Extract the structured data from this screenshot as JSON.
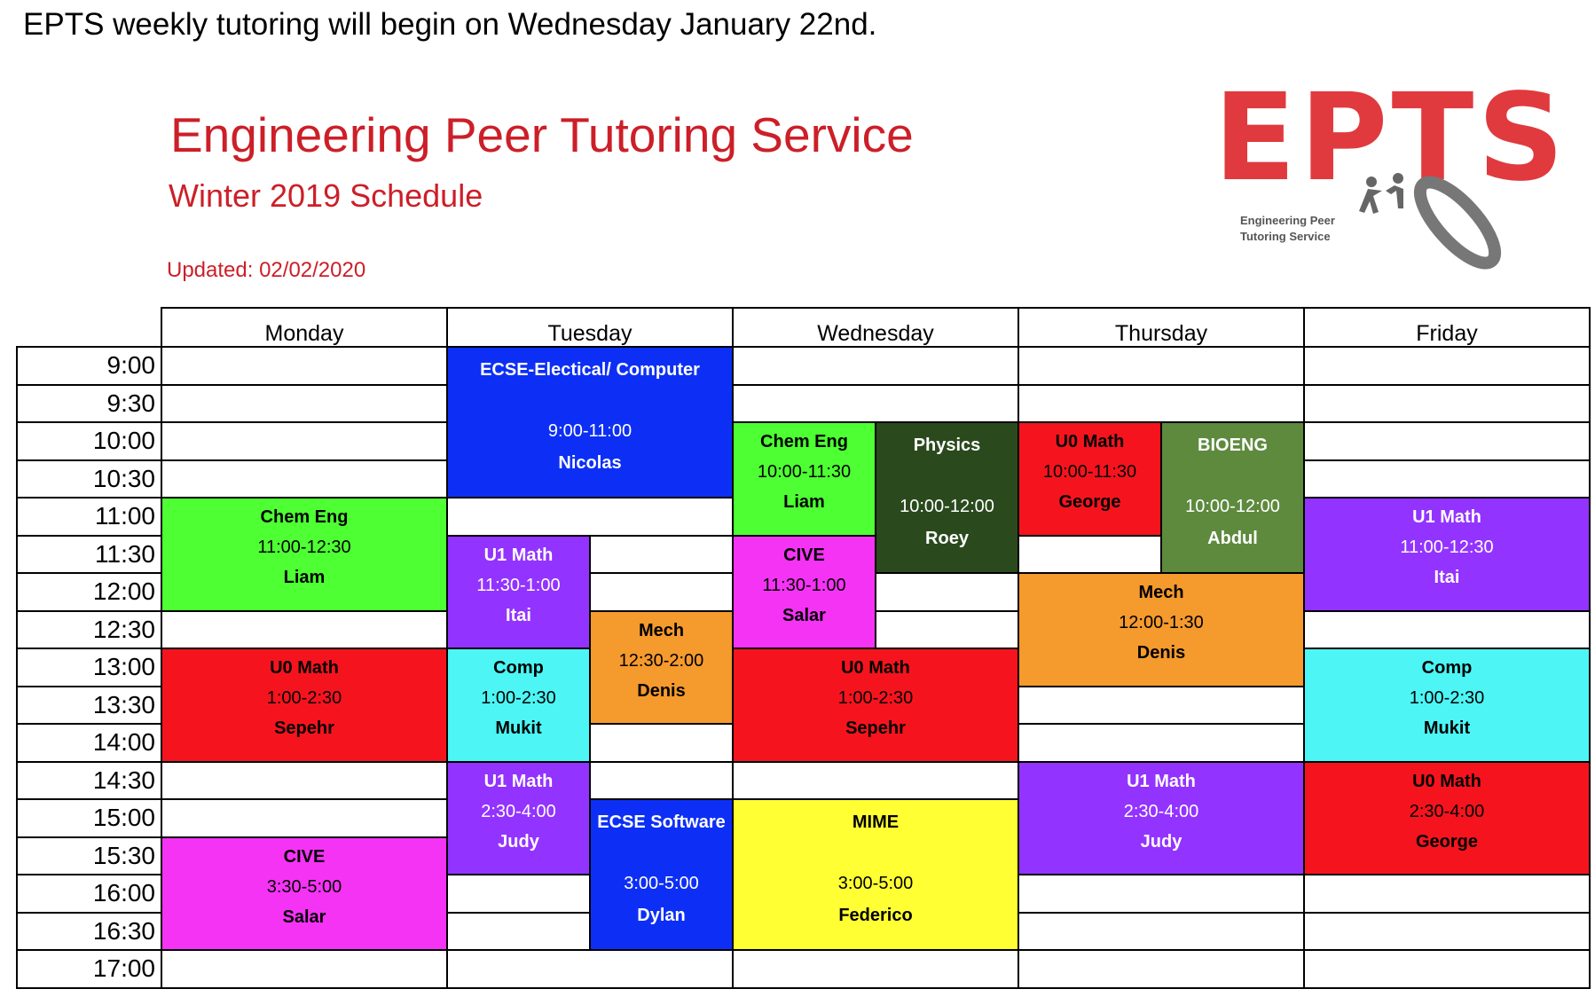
{
  "notice": "EPTS weekly tutoring will begin on Wednesday January 22nd.",
  "title": "Engineering Peer Tutoring Service",
  "subtitle": "Winter 2019 Schedule",
  "updated": "Updated: 02/02/2020",
  "logo": {
    "word": "EPTS",
    "tagline_line1": "Engineering Peer",
    "tagline_line2": "Tutoring Service"
  },
  "colors": {
    "brand_red": "#cc1f28",
    "green": "#4dff33",
    "blue": "#0d2ff5",
    "purple": "#9333ff",
    "magenta": "#f533f5",
    "red": "#f5141e",
    "cyan": "#4df5f5",
    "orange": "#f59a2d",
    "darkgreen": "#2a4a1d",
    "olive": "#5e8a3e",
    "yellow": "#ffff33"
  },
  "days": [
    "Monday",
    "Tuesday",
    "Wednesday",
    "Thursday",
    "Friday"
  ],
  "times": [
    "9:00",
    "9:30",
    "10:00",
    "10:30",
    "11:00",
    "11:30",
    "12:00",
    "12:30",
    "13:00",
    "13:30",
    "14:00",
    "14:30",
    "15:00",
    "15:30",
    "16:00",
    "16:30",
    "17:00"
  ],
  "sessions": [
    {
      "day": "Tuesday",
      "subject": "ECSE-Electical/ Computer",
      "time": "9:00-11:00",
      "tutor": "Nicolas",
      "color": "#0d2ff5"
    },
    {
      "day": "Wednesday",
      "subject": "Chem Eng",
      "time": "10:00-11:30",
      "tutor": "Liam",
      "color": "#4dff33"
    },
    {
      "day": "Wednesday",
      "subject": "Physics",
      "time": "10:00-12:00",
      "tutor": "Roey",
      "color": "#2a4a1d"
    },
    {
      "day": "Thursday",
      "subject": "U0 Math",
      "time": "10:00-11:30",
      "tutor": "George",
      "color": "#f5141e"
    },
    {
      "day": "Thursday",
      "subject": "BIOENG",
      "time": "10:00-12:00",
      "tutor": "Abdul",
      "color": "#5e8a3e"
    },
    {
      "day": "Monday",
      "subject": "Chem Eng",
      "time": "11:00-12:30",
      "tutor": "Liam",
      "color": "#4dff33"
    },
    {
      "day": "Friday",
      "subject": "U1 Math",
      "time": "11:00-12:30",
      "tutor": "Itai",
      "color": "#9333ff"
    },
    {
      "day": "Tuesday",
      "subject": "U1 Math",
      "time": "11:30-1:00",
      "tutor": "Itai",
      "color": "#9333ff"
    },
    {
      "day": "Wednesday",
      "subject": "CIVE",
      "time": "11:30-1:00",
      "tutor": "Salar",
      "color": "#f533f5"
    },
    {
      "day": "Thursday",
      "subject": "Mech",
      "time": "12:00-1:30",
      "tutor": "Denis",
      "color": "#f59a2d"
    },
    {
      "day": "Tuesday",
      "subject": "Mech",
      "time": "12:30-2:00",
      "tutor": "Denis",
      "color": "#f59a2d"
    },
    {
      "day": "Monday",
      "subject": "U0 Math",
      "time": "1:00-2:30",
      "tutor": "Sepehr",
      "color": "#f5141e"
    },
    {
      "day": "Tuesday",
      "subject": "Comp",
      "time": "1:00-2:30",
      "tutor": "Mukit",
      "color": "#4df5f5"
    },
    {
      "day": "Wednesday",
      "subject": "U0 Math",
      "time": "1:00-2:30",
      "tutor": "Sepehr",
      "color": "#f5141e"
    },
    {
      "day": "Friday",
      "subject": "Comp",
      "time": "1:00-2:30",
      "tutor": "Mukit",
      "color": "#4df5f5"
    },
    {
      "day": "Tuesday",
      "subject": "U1 Math",
      "time": "2:30-4:00",
      "tutor": "Judy",
      "color": "#9333ff"
    },
    {
      "day": "Thursday",
      "subject": "U1 Math",
      "time": "2:30-4:00",
      "tutor": "Judy",
      "color": "#9333ff"
    },
    {
      "day": "Friday",
      "subject": "U0 Math",
      "time": "2:30-4:00",
      "tutor": "George",
      "color": "#f5141e"
    },
    {
      "day": "Tuesday",
      "subject": "ECSE Software",
      "time": "3:00-5:00",
      "tutor": "Dylan",
      "color": "#0d2ff5"
    },
    {
      "day": "Wednesday",
      "subject": "MIME",
      "time": "3:00-5:00",
      "tutor": "Federico",
      "color": "#ffff33"
    },
    {
      "day": "Monday",
      "subject": "CIVE",
      "time": "3:30-5:00",
      "tutor": "Salar",
      "color": "#f533f5"
    }
  ]
}
